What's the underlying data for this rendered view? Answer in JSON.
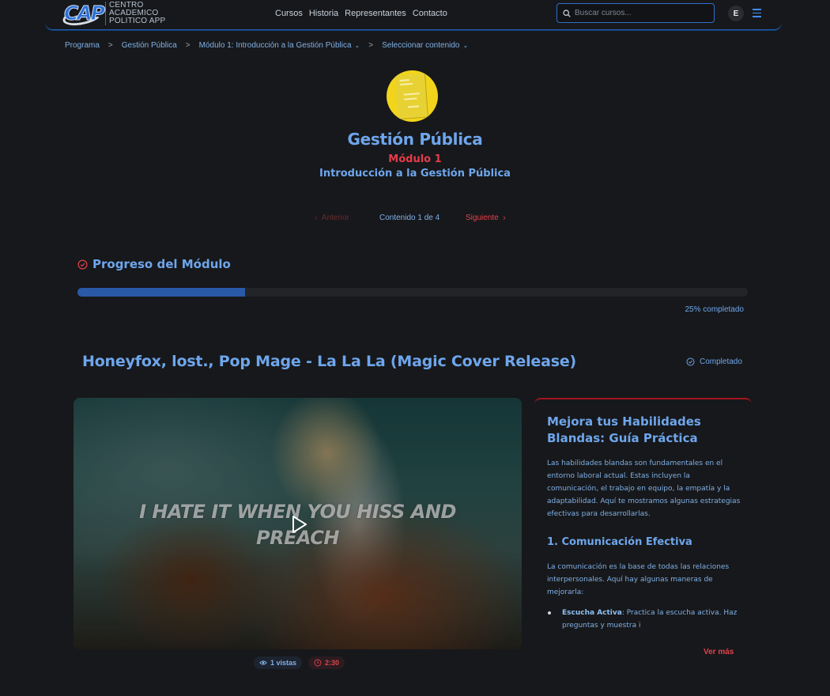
{
  "header": {
    "logo_letters": "CAP",
    "brand_line1": "CENTRO",
    "brand_line2": "ACADEMICO",
    "brand_line3": "POLITICO APP",
    "nav": [
      "Cursos",
      "Historia",
      "Representantes",
      "Contacto"
    ],
    "search_placeholder": "Buscar cursos...",
    "avatar_initial": "E"
  },
  "breadcrumb": {
    "items": [
      "Programa",
      "Gestión Pública",
      "Módulo 1: Introducción a la Gestión Pública",
      "Seleccionar contenido"
    ],
    "separator": ">"
  },
  "course": {
    "title": "Gestión Pública",
    "module_label": "Módulo 1",
    "module_name": "Introducción a la Gestión Pública"
  },
  "pager": {
    "prev": "Anterior",
    "count": "Contenido 1 de 4",
    "next": "Siguiente"
  },
  "progress": {
    "title": "Progreso del Módulo",
    "percent": 25,
    "label": "25% completado"
  },
  "content": {
    "title": "Honeyfox, lost., Pop Mage - La La La (Magic Cover Release)",
    "status": "Completado",
    "lyric_line1": "I HATE IT WHEN YOU HISS AND",
    "lyric_line2": "PREACH",
    "views": "1 vistas",
    "duration": "2:30"
  },
  "article": {
    "title": "Mejora tus Habilidades Blandas: Guía Práctica",
    "intro": "Las habilidades blandas son fundamentales en el entorno laboral actual. Estas incluyen la comunicación, el trabajo en equipo, la empatía y la adaptabilidad. Aquí te mostramos algunas estrategias efectivas para desarrollarlas.",
    "section1_title": "1. Comunicación Efectiva",
    "section1_text": "La comunicación es la base de todas las relaciones interpersonales. Aquí hay algunas maneras de mejorarla:",
    "bullet1_strong": "Escucha Activa",
    "bullet1_text": ": Practica la escucha activa. Haz preguntas y muestra i",
    "more": "Ver más"
  },
  "colors": {
    "background": "#17181b",
    "accent_blue": "#6ea6ec",
    "accent_red": "#e0424c",
    "progress_fill": "#2a59a8",
    "logo_yellow": "#f2d51b"
  },
  "icons": {
    "search": "search-icon",
    "menu": "hamburger-icon",
    "progress": "check-circle-icon",
    "completed": "check-circle-icon",
    "play": "play-icon",
    "views": "eye-icon",
    "duration": "clock-icon"
  }
}
